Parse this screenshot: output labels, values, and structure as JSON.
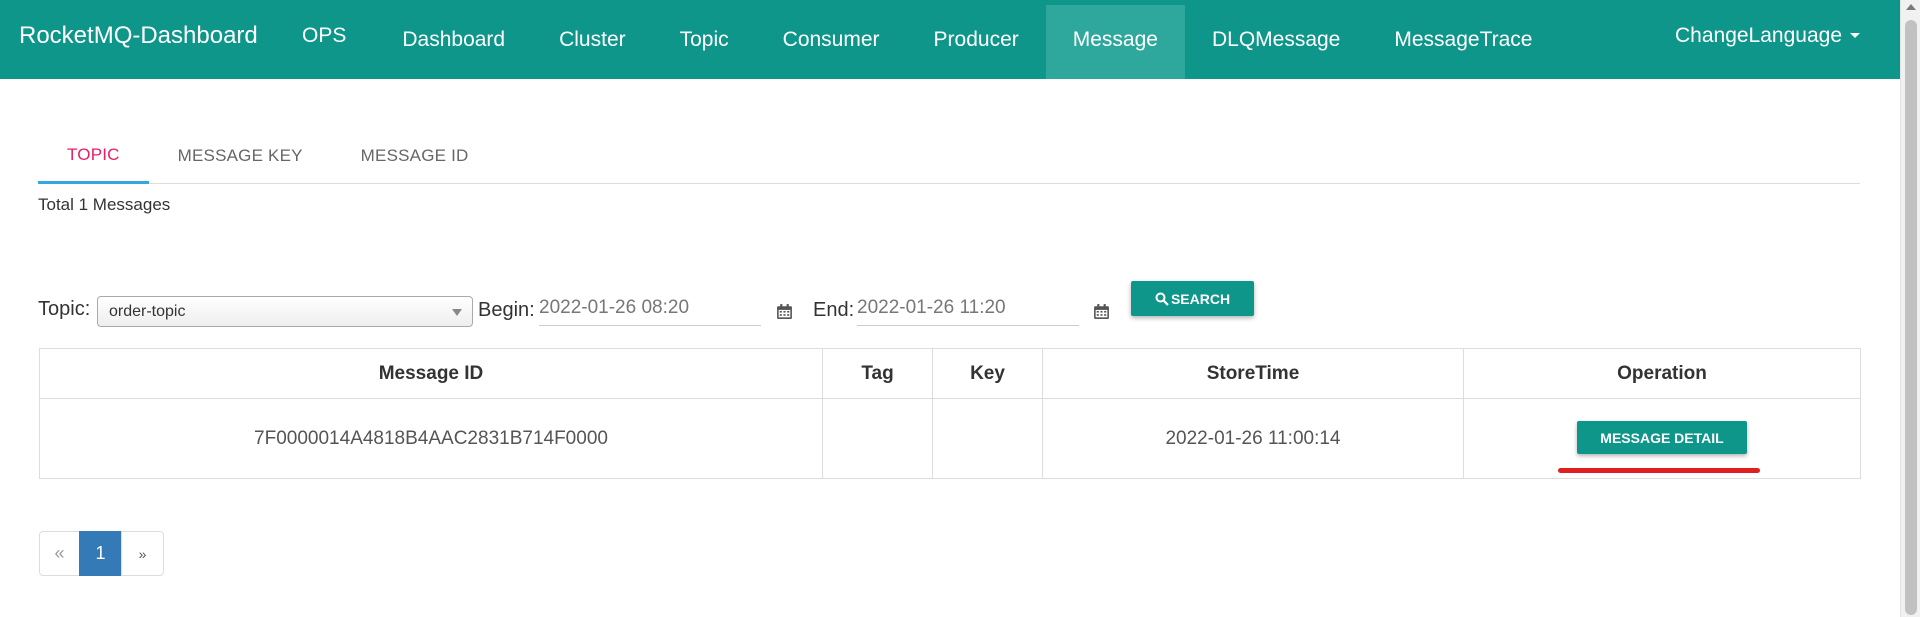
{
  "navbar": {
    "brand": "RocketMQ-Dashboard",
    "items": [
      {
        "label": "OPS"
      },
      {
        "label": "Dashboard"
      },
      {
        "label": "Cluster"
      },
      {
        "label": "Topic"
      },
      {
        "label": "Consumer"
      },
      {
        "label": "Producer"
      },
      {
        "label": "Message"
      },
      {
        "label": "DLQMessage"
      },
      {
        "label": "MessageTrace"
      }
    ],
    "active": "Message",
    "language_label": "ChangeLanguage"
  },
  "tabs": [
    {
      "label": "TOPIC",
      "active": true
    },
    {
      "label": "MESSAGE KEY",
      "active": false
    },
    {
      "label": "MESSAGE ID",
      "active": false
    }
  ],
  "summary": "Total 1 Messages",
  "filter": {
    "topic_label": "Topic:",
    "topic_value": "order-topic",
    "begin_label": "Begin:",
    "begin_value": "2022-01-26 08:20",
    "end_label": "End:",
    "end_value": "2022-01-26 11:20",
    "search_label": "SEARCH"
  },
  "table": {
    "columns": [
      "Message ID",
      "Tag",
      "Key",
      "StoreTime",
      "Operation"
    ],
    "rows": [
      {
        "message_id": "7F0000014A4818B4AAC2831B714F0000",
        "tag": "",
        "key": "",
        "store_time": "2022-01-26 11:00:14",
        "operation_label": "MESSAGE DETAIL"
      }
    ]
  },
  "pagination": {
    "prev": "«",
    "current": "1",
    "next": "»"
  },
  "colors": {
    "navbar": "#0e968a",
    "active_nav": "#2ea89c",
    "active_tab_text": "#e91e63",
    "active_tab_underline": "#35a7e0",
    "button": "#0e968a",
    "page_active": "#337ab7",
    "highlight_underline": "#e02020"
  },
  "icons": {
    "calendar": "calendar-icon",
    "search": "search-icon",
    "dropdown": "chevron-down-icon"
  }
}
